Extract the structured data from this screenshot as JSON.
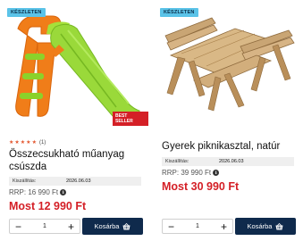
{
  "products": [
    {
      "badge": "KÉSZLETEN",
      "bestseller": "BEST SELLER",
      "rating_count": "(1)",
      "stars": 5,
      "title": "Összecsukható műanyag csúszda",
      "ship_label": "Kiszállítás:",
      "ship_date": "2026.06.03",
      "rrp": "RRP: 16 990 Ft",
      "price": "Most 12 990 Ft",
      "qty_minus": "−",
      "qty_value": "1",
      "qty_plus": "+",
      "cart_label": "Kosárba",
      "image": "slide-illustration"
    },
    {
      "badge": "KÉSZLETEN",
      "title": "Gyerek piknikasztal, natúr",
      "ship_label": "Kiszállítás:",
      "ship_date": "2026.06.03",
      "rrp": "RRP: 39 990 Ft",
      "price": "Most 30 990 Ft",
      "qty_minus": "−",
      "qty_value": "1",
      "qty_plus": "+",
      "cart_label": "Kosárba",
      "image": "picnic-table-illustration"
    }
  ],
  "colors": {
    "badge_bg": "#5bc3e8",
    "price_red": "#d41f26",
    "cart_navy": "#0f2a4c",
    "star_orange": "#e3562e"
  },
  "icons": {
    "star": "star-icon",
    "info": "info-icon",
    "cart": "basket-icon"
  }
}
